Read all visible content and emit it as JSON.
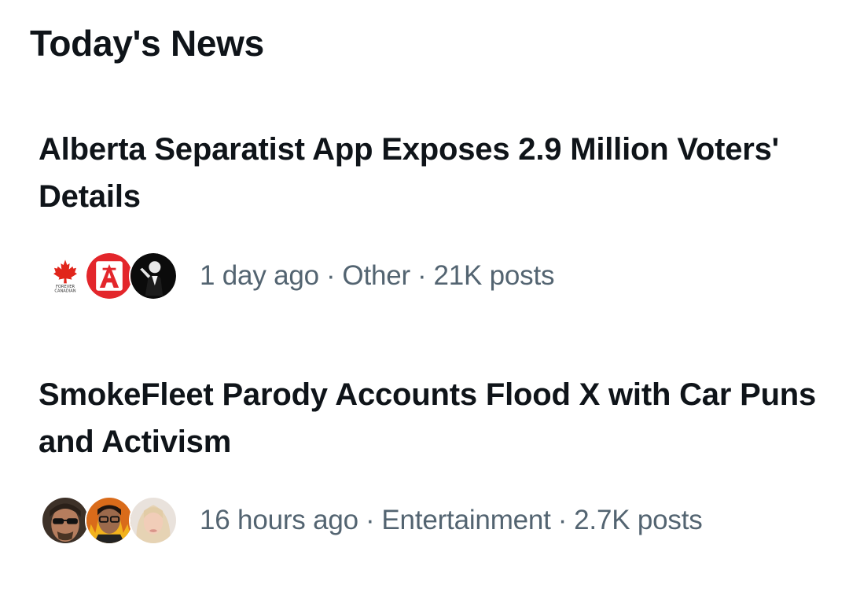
{
  "section": {
    "title": "Today's News"
  },
  "stories": [
    {
      "headline": "Alberta Separatist App Exposes 2.9 Million Voters' Details",
      "time": "1 day ago",
      "category": "Other",
      "posts": "21K posts",
      "separator": "·",
      "avatars": [
        {
          "icon": "forever-canadian-logo-icon",
          "label": "FOREVER CANADIAN"
        },
        {
          "icon": "red-a-logo-icon"
        },
        {
          "icon": "person-silhouette-icon"
        }
      ]
    },
    {
      "headline": "SmokeFleet Parody Accounts Flood X with Car Puns and Activism",
      "time": "16 hours ago",
      "category": "Entertainment",
      "posts": "2.7K posts",
      "separator": "·",
      "avatars": [
        {
          "icon": "man-with-sunglasses-avatar-icon"
        },
        {
          "icon": "man-with-glasses-flames-avatar-icon"
        },
        {
          "icon": "blonde-woman-avatar-icon"
        }
      ]
    }
  ],
  "colors": {
    "text_primary": "#0f1419",
    "text_secondary": "#536471",
    "canada_red": "#e1251b"
  }
}
